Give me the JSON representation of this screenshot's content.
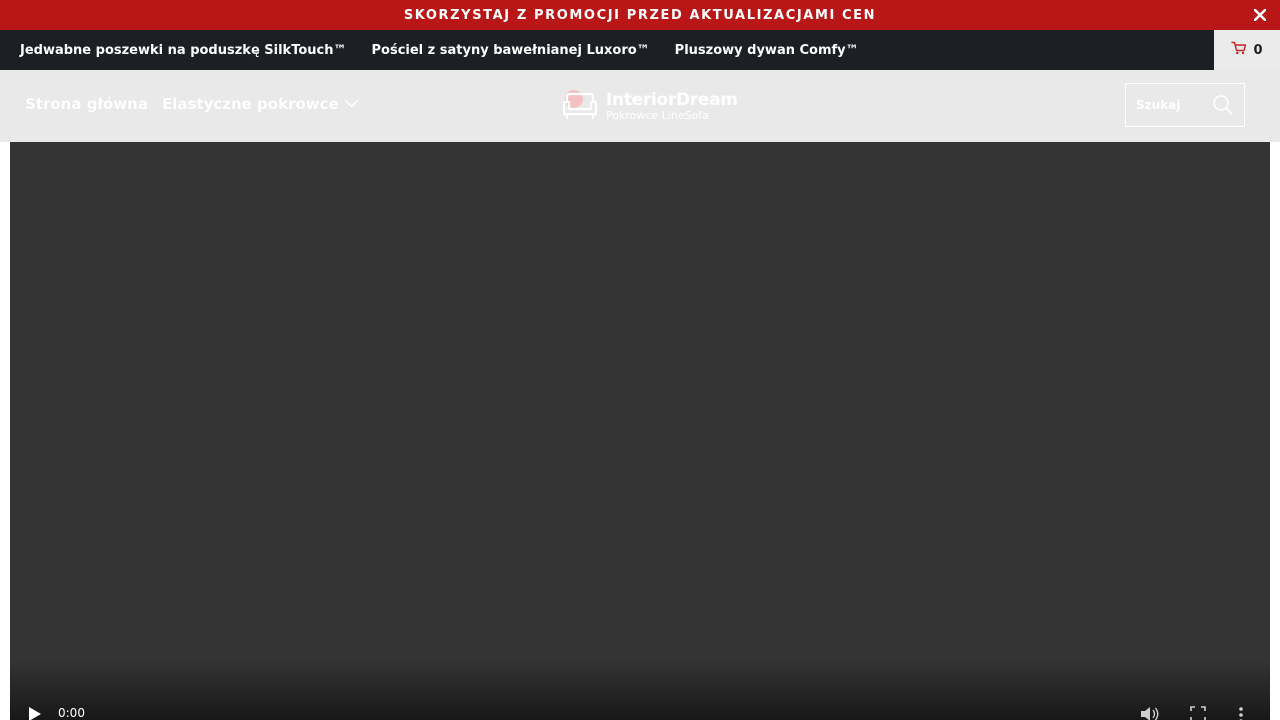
{
  "promo": {
    "text": "SKORZYSTAJ Z PROMOCJI PRZED AKTUALIZACJAMI CEN"
  },
  "top_nav": {
    "links": [
      "Jedwabne poszewki na poduszkę SilkTouch™",
      "Pościel z satyny bawełnianej Luxoro™",
      "Pluszowy dywan Comfy™"
    ],
    "cart_count": "0"
  },
  "header": {
    "menu": {
      "home": "Strona główna",
      "covers": "Elastyczne pokrowce"
    },
    "logo": {
      "name": "InteriorDream",
      "tagline": "Pokrowce LineSofa"
    },
    "search": {
      "placeholder": "Szukaj"
    }
  },
  "video": {
    "time": "0:00"
  },
  "colors": {
    "promo_bg": "#b91717",
    "top_nav_bg": "#1c1f24",
    "header_bg": "#e8e9e8",
    "video_bg": "#343434",
    "cart_bg": "#ebebeb"
  },
  "icons": {
    "promo_close": "close-icon",
    "cart": "cart-icon",
    "dropdown": "chevron-down-icon",
    "logo": "sofa-icon",
    "search": "search-icon",
    "play": "play-icon",
    "volume": "volume-icon",
    "fullscreen": "fullscreen-icon",
    "more": "more-icon"
  }
}
